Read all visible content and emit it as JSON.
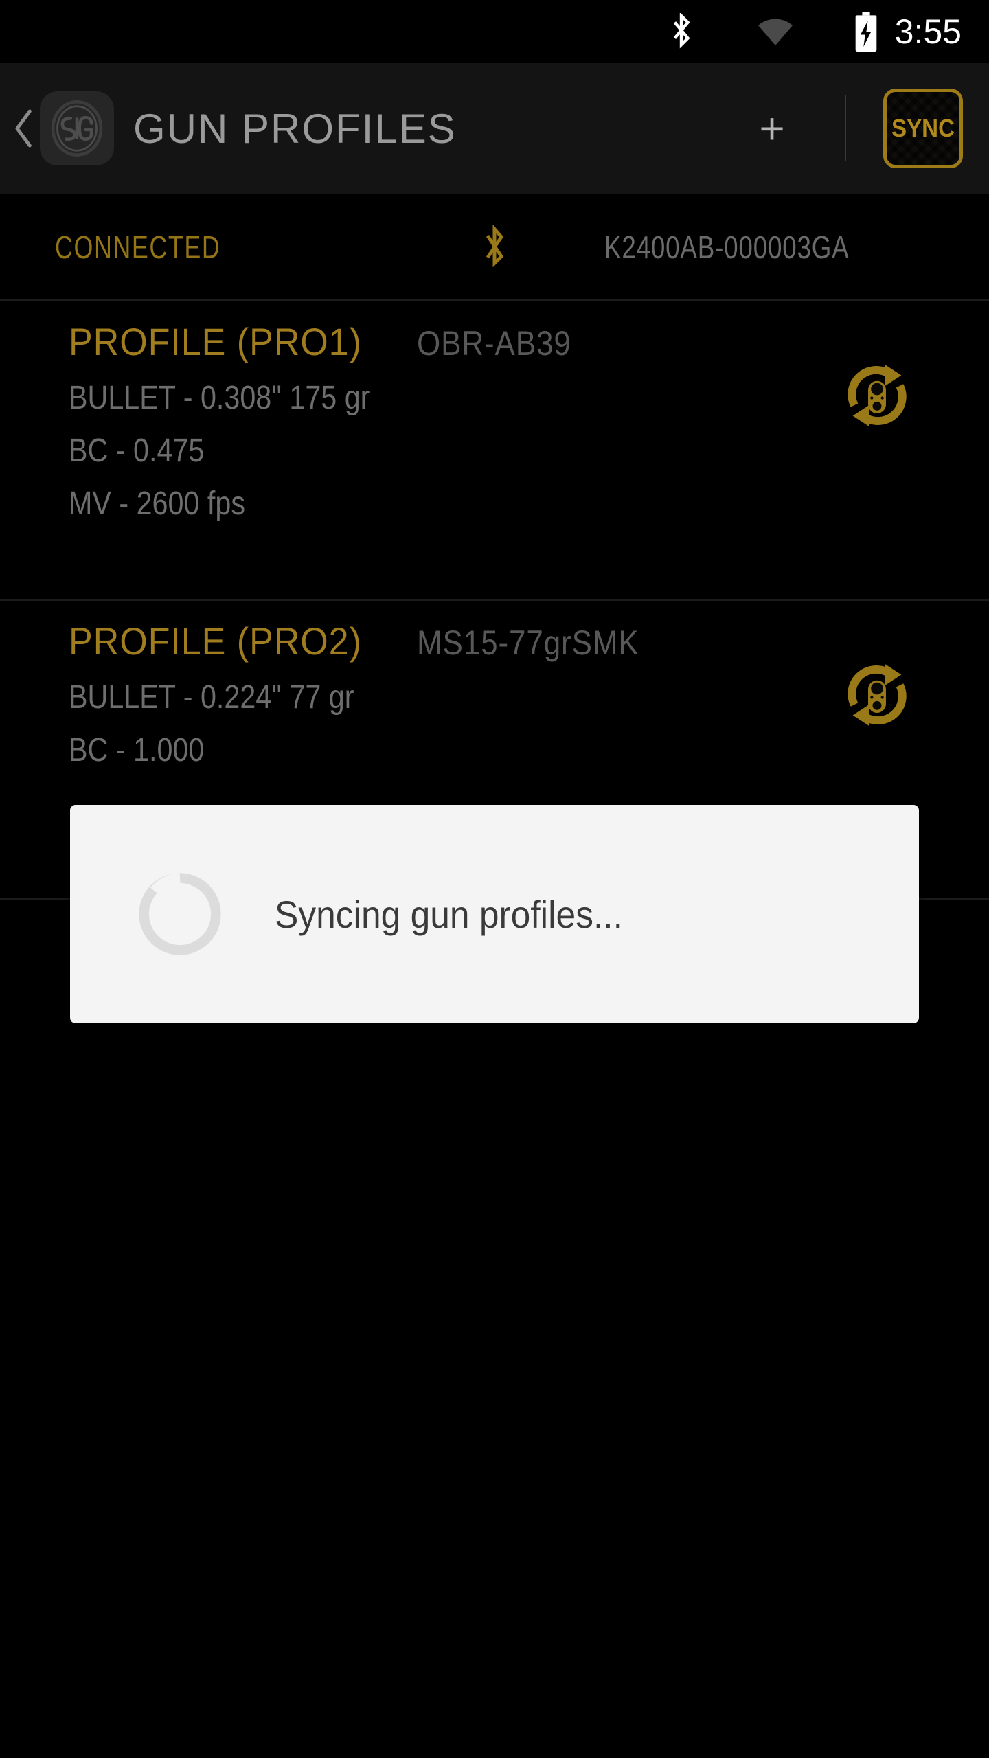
{
  "status_bar": {
    "time": "3:55",
    "icons": [
      "bluetooth-icon",
      "wifi-icon",
      "battery-charging-icon"
    ]
  },
  "header": {
    "back_icon": "back-chevron-icon",
    "brand_logo": "sig-sauer-logo",
    "title": "GUN PROFILES",
    "add_label": "+",
    "sync_label": "SYNC"
  },
  "connection": {
    "status": "CONNECTED",
    "bluetooth_icon": "bluetooth-icon",
    "device_serial": "K2400AB-000003GA",
    "accent_color": "#937416"
  },
  "profiles": [
    {
      "name": "PROFILE (PRO1)",
      "tag": "OBR-AB39",
      "bullet": "BULLET - 0.308\" 175 gr",
      "bc": "BC -  0.475",
      "mv": "MV -  2600 fps",
      "sync_icon": "sync-arrows-icon"
    },
    {
      "name": "PROFILE (PRO2)",
      "tag": "MS15-77grSMK",
      "bullet": "BULLET - 0.224\"  77 gr",
      "bc": "BC - 1.000",
      "mv": "",
      "sync_icon": "sync-arrows-icon"
    }
  ],
  "dialog": {
    "message": "Syncing gun profiles...",
    "spinner_icon": "loading-spinner-icon"
  },
  "theme": {
    "background": "#000000",
    "header_background": "#141414",
    "accent_gold": "#a07d1e",
    "text_gray": "#6e6e6e",
    "dialog_background": "#f4f4f4"
  }
}
